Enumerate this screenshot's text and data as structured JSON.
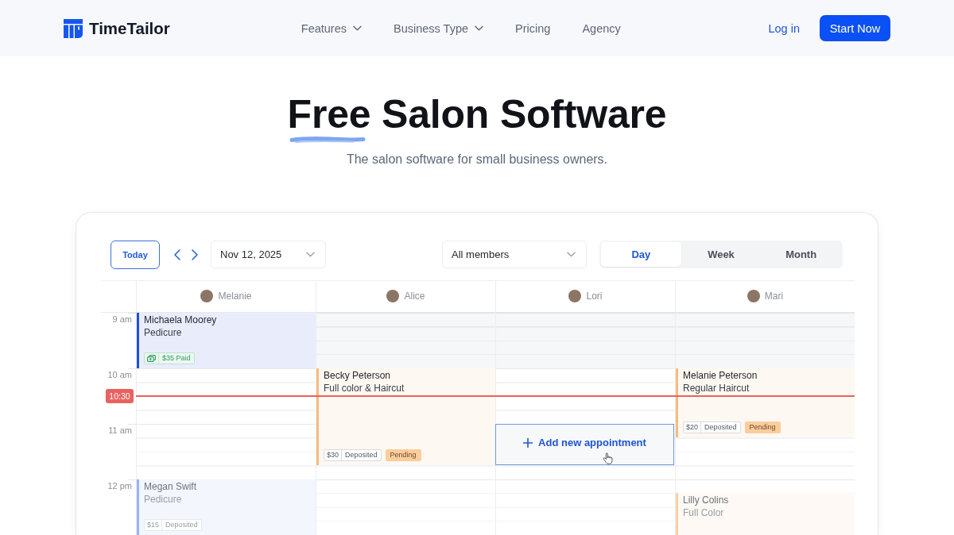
{
  "header": {
    "brand": "TimeTailor",
    "nav": [
      {
        "label": "Features",
        "dropdown": true
      },
      {
        "label": "Business Type",
        "dropdown": true
      },
      {
        "label": "Pricing",
        "dropdown": false
      },
      {
        "label": "Agency",
        "dropdown": false
      }
    ],
    "login": "Log in",
    "cta": "Start Now"
  },
  "hero": {
    "title": "Free Salon Software",
    "subtitle": "The salon software for small business owners."
  },
  "calendar": {
    "toolbar": {
      "today": "Today",
      "date": "Nov 12, 2025",
      "member_filter": "All members",
      "views": [
        {
          "label": "Day",
          "selected": true
        },
        {
          "label": "Week",
          "selected": false
        },
        {
          "label": "Month",
          "selected": false
        }
      ]
    },
    "hours": [
      "9 am",
      "10 am",
      "11 am",
      "12 pm"
    ],
    "now": {
      "label": "10:30"
    },
    "columns": [
      {
        "name": "Melanie",
        "appointments": [
          {
            "kind": "booking",
            "client": "Michaela Moorey",
            "service": "Pedicure",
            "color": "#1f4fd8",
            "faded": false,
            "payment": {
              "kind": "paid",
              "text": "$35 Paid"
            }
          },
          {
            "kind": "booking",
            "client": "Megan Swift",
            "service": "Pedicure",
            "color": "#9ab4f0",
            "faded": true,
            "payment": {
              "kind": "deposit",
              "amount": "$15",
              "text": "Deposited"
            }
          }
        ]
      },
      {
        "name": "Alice",
        "appointments": [
          {
            "kind": "blocked"
          },
          {
            "kind": "booking",
            "client": "Becky Peterson",
            "service": "Full color & Haircut",
            "color": "#f6bb80",
            "faded": false,
            "payment": {
              "kind": "deposit",
              "amount": "$30",
              "text": "Deposited"
            },
            "status": "Pending"
          }
        ]
      },
      {
        "name": "Lori",
        "appointments": [
          {
            "kind": "blocked"
          },
          {
            "kind": "new",
            "label": "Add new appointment",
            "hovered": true
          }
        ]
      },
      {
        "name": "Mari",
        "appointments": [
          {
            "kind": "blocked"
          },
          {
            "kind": "booking",
            "client": "Melanie Peterson",
            "service": "Regular Haircut",
            "color": "#f6bb80",
            "faded": false,
            "payment": {
              "kind": "deposit",
              "amount": "$20",
              "text": "Deposited"
            },
            "status": "Pending"
          },
          {
            "kind": "booking",
            "client": "Lilly Colins",
            "service": "Full Color",
            "color": "#f8d0a4",
            "faded": true
          }
        ]
      }
    ]
  }
}
